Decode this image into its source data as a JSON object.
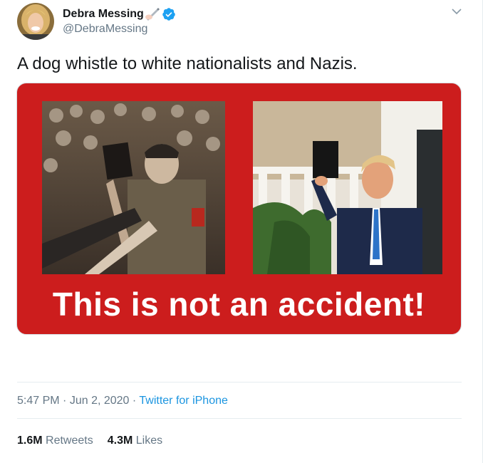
{
  "tweet": {
    "author": {
      "display_name": "Debra Messing",
      "handle": "@DebraMessing",
      "verified": true,
      "name_emoji": "writing-hand-emoji"
    },
    "text": "A dog whistle to white nationalists and Nazis.",
    "media": {
      "caption": "This is not an accident!",
      "background_color": "#cc1d1d"
    },
    "meta": {
      "time": "5:47 PM",
      "separator": "·",
      "date": "Jun 2, 2020",
      "source": "Twitter for iPhone"
    },
    "stats": {
      "retweets_count": "1.6M",
      "retweets_label": "Retweets",
      "likes_count": "4.3M",
      "likes_label": "Likes"
    }
  },
  "colors": {
    "link": "#1b95e0",
    "secondary_text": "#657786",
    "primary_text": "#14171a",
    "verified": "#1da1f2"
  }
}
